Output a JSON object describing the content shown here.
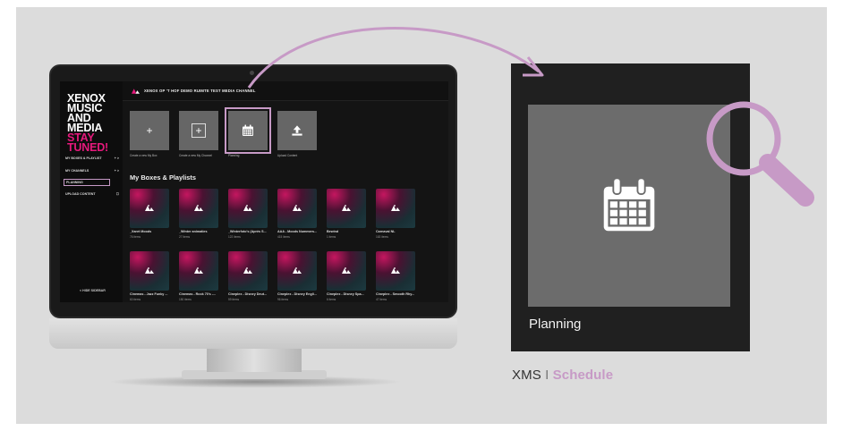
{
  "colors": {
    "accent_pink": "#e6197c",
    "highlight_purple": "#c79ac6",
    "tile_gray": "#666666",
    "panel_dark": "#202020"
  },
  "app": {
    "brand_lines": [
      "XENOX",
      "MUSIC",
      "AND",
      "MEDIA"
    ],
    "brand_accent_lines": [
      "STAY",
      "TUNED!"
    ],
    "breadcrumb": "XENOX OP 'T HOF  DEMO RUIMTE  TEST MEDIA CHANNEL",
    "sidebar": {
      "items": [
        {
          "label": "MY BOXES & PLAYLIST",
          "trailing": "+ >"
        },
        {
          "label": "MY CHANNELS",
          "trailing": "+ >"
        },
        {
          "label": "PLANNING",
          "trailing": ""
        },
        {
          "label": "UPLOAD CONTENT",
          "trailing": "☐"
        }
      ],
      "hide_label": "< HIDE SIDEBAR"
    },
    "actions": [
      {
        "icon": "plus-icon",
        "label": "Create a new My Box"
      },
      {
        "icon": "plus-icon",
        "label": "Create a new My Channel"
      },
      {
        "icon": "calendar-icon",
        "label": "Planning"
      },
      {
        "icon": "upload-icon",
        "label": "Upload Content"
      }
    ],
    "section_title": "My Boxes & Playlists",
    "boxes": [
      {
        "title": "_Xaret Moods",
        "count": "76 items"
      },
      {
        "title": "_Winter animaties",
        "count": "27 items"
      },
      {
        "title": "_Winterfoto's (Après S...",
        "count": "122 items"
      },
      {
        "title": "AAA - Moods Nummers...",
        "count": "415 items"
      },
      {
        "title": "Bewind",
        "count": "1 items"
      },
      {
        "title": "Carnaval NL",
        "count": "163 items"
      },
      {
        "title": "Cinemas - Jazz Funky ...",
        "count": "60 items"
      },
      {
        "title": "Cinemas - Rock 70's -...",
        "count": "150 items"
      },
      {
        "title": "Cineplex - Disney Deut...",
        "count": "59 items"
      },
      {
        "title": "Cineplex - Disney Engli...",
        "count": "96 items"
      },
      {
        "title": "Cineplex - Disney Spa...",
        "count": "6 items"
      },
      {
        "title": "Cineplex - Smooth Rhy...",
        "count": "47 items"
      }
    ]
  },
  "zoom": {
    "label": "Planning",
    "icon": "calendar-icon",
    "magnifier_icon": "magnifier-icon"
  },
  "caption": {
    "prefix": "XMS",
    "separator": "I",
    "highlight": "Schedule"
  }
}
